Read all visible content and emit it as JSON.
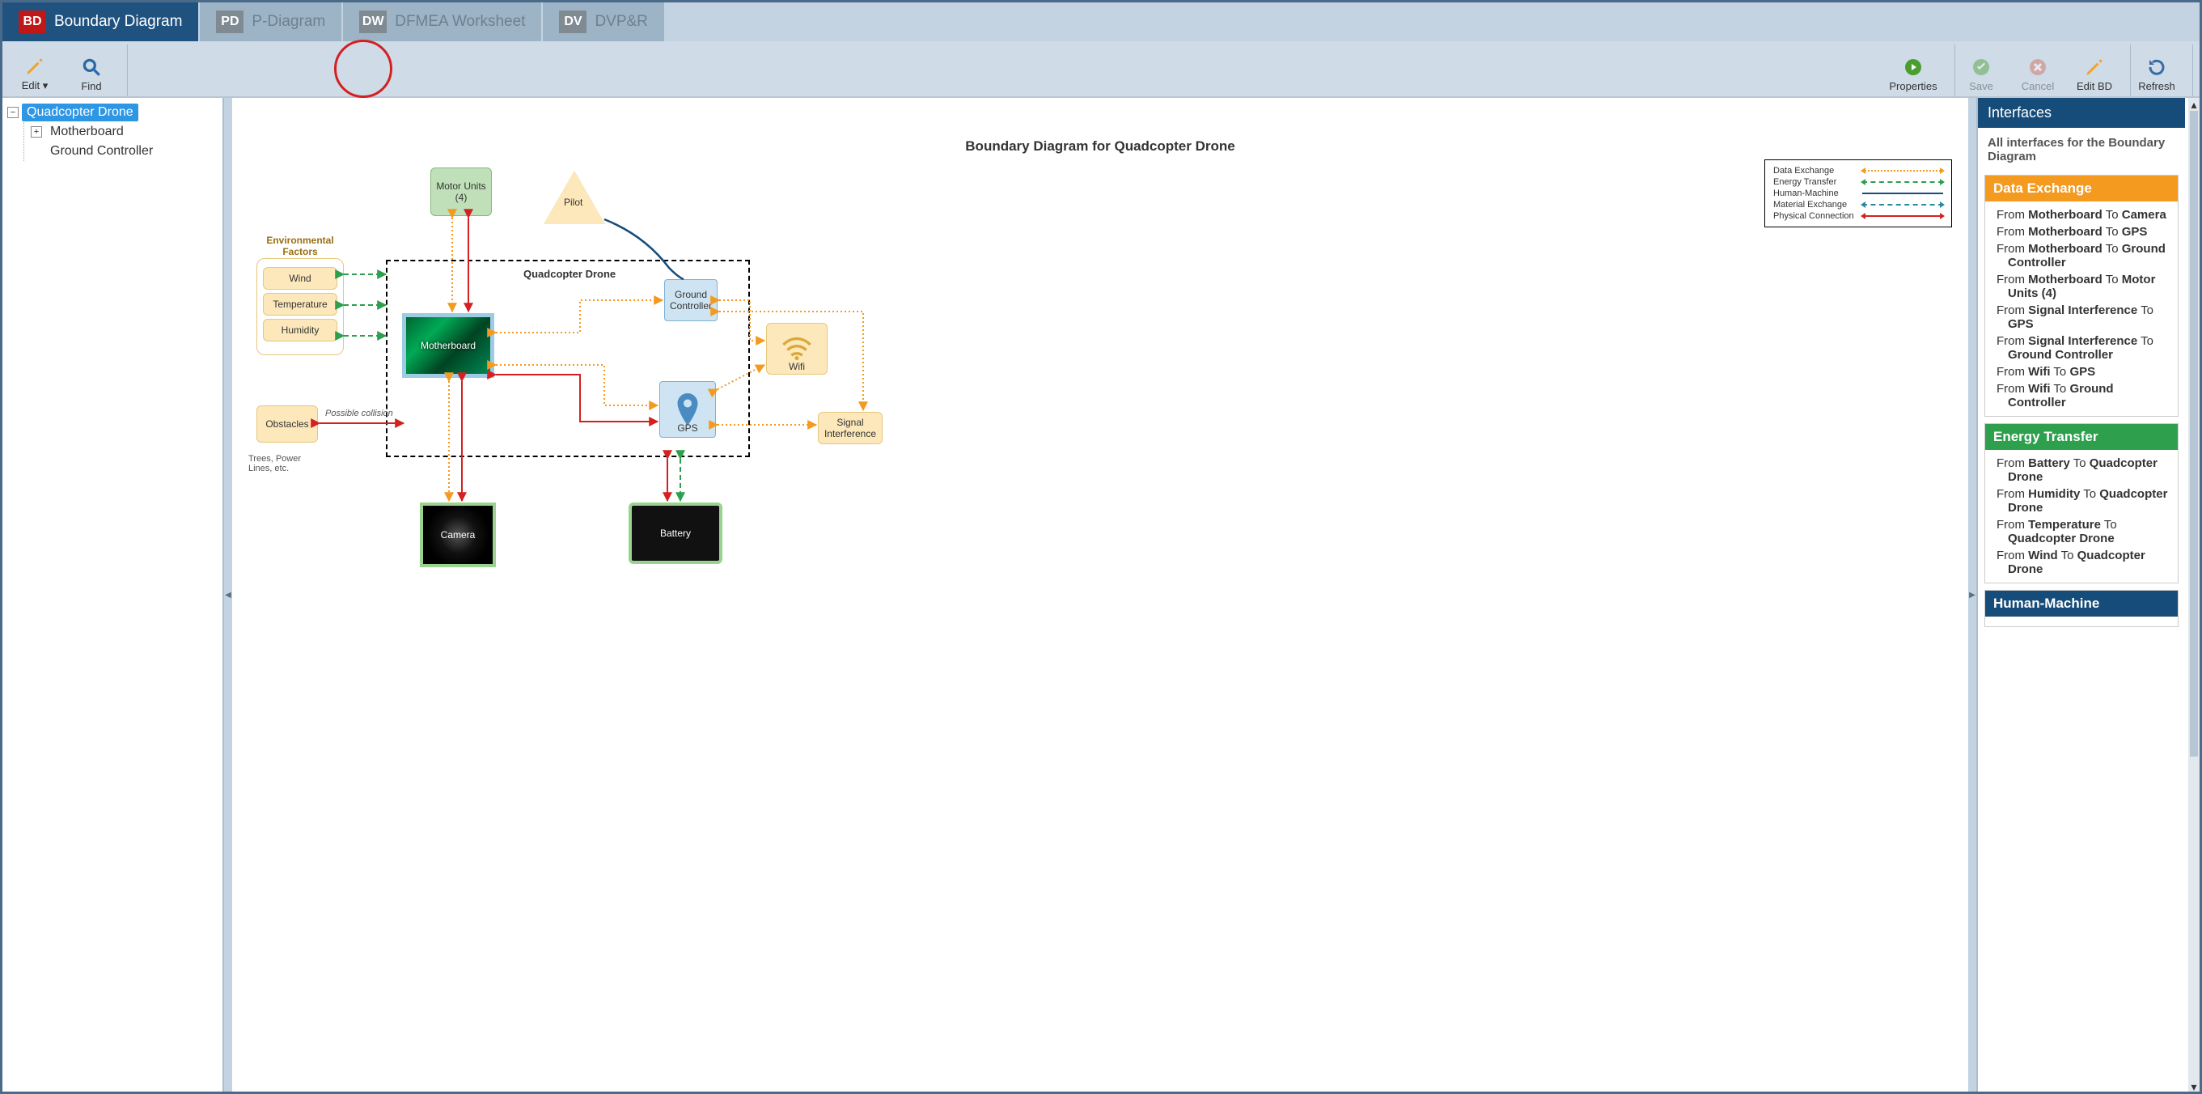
{
  "tabs": [
    {
      "badge": "BD",
      "label": "Boundary Diagram",
      "active": true
    },
    {
      "badge": "PD",
      "label": "P-Diagram",
      "active": false
    },
    {
      "badge": "DW",
      "label": "DFMEA Worksheet",
      "active": false
    },
    {
      "badge": "DV",
      "label": "DVP&R",
      "active": false
    }
  ],
  "toolbar": {
    "edit": "Edit",
    "find": "Find",
    "properties": "Properties",
    "save": "Save",
    "cancel": "Cancel",
    "edit_bd": "Edit BD",
    "refresh": "Refresh"
  },
  "tree": {
    "root": "Quadcopter Drone",
    "children": [
      "Motherboard",
      "Ground Controller"
    ]
  },
  "diagram": {
    "title": "Boundary Diagram for Quadcopter Drone",
    "boundary_label": "Quadcopter Drone",
    "motor_units": "Motor Units (4)",
    "pilot": "Pilot",
    "ground_controller": "Ground Controller",
    "wifi": "Wifi",
    "gps": "GPS",
    "signal_interference": "Signal Interference",
    "motherboard": "Motherboard",
    "camera": "Camera",
    "battery": "Battery",
    "obstacles": "Obstacles",
    "env_title": "Environmental Factors",
    "env_items": [
      "Wind",
      "Temperature",
      "Humidity"
    ],
    "note_collision": "Possible collision",
    "note_trees": "Trees, Power Lines, etc.",
    "legend": {
      "data": "Data Exchange",
      "energy": "Energy Transfer",
      "human": "Human-Machine",
      "material": "Material Exchange",
      "physical": "Physical Connection"
    }
  },
  "right": {
    "title": "Interfaces",
    "subtitle": "All interfaces for the Boundary Diagram",
    "groups": [
      {
        "name": "Data Exchange",
        "color": "orange",
        "items": [
          [
            "Motherboard",
            "Camera"
          ],
          [
            "Motherboard",
            "GPS"
          ],
          [
            "Motherboard",
            "Ground Controller"
          ],
          [
            "Motherboard",
            "Motor Units (4)"
          ],
          [
            "Signal Interference",
            "GPS"
          ],
          [
            "Signal Interference",
            "Ground Controller"
          ],
          [
            "Wifi",
            "GPS"
          ],
          [
            "Wifi",
            "Ground Controller"
          ]
        ]
      },
      {
        "name": "Energy Transfer",
        "color": "green",
        "items": [
          [
            "Battery",
            "Quadcopter Drone"
          ],
          [
            "Humidity",
            "Quadcopter Drone"
          ],
          [
            "Temperature",
            "Quadcopter Drone"
          ],
          [
            "Wind",
            "Quadcopter Drone"
          ]
        ]
      },
      {
        "name": "Human-Machine",
        "color": "navy",
        "items": []
      }
    ]
  }
}
